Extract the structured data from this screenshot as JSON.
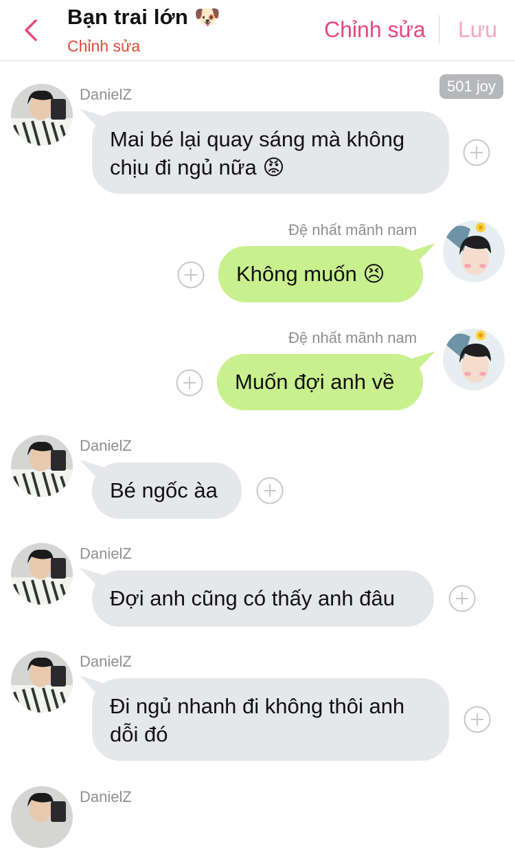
{
  "header": {
    "title": "Bạn trai lớn 🐶",
    "subtitle": "Chỉnh sửa",
    "edit_label": "Chỉnh sửa",
    "save_label": "Lưu"
  },
  "joy_badge": "501 joy",
  "messages": [
    {
      "sender": "DanielZ",
      "text": "Mai bé lại quay sáng mà không chịu đi ngủ nữa 😡",
      "side": "in"
    },
    {
      "sender": "Đệ nhất mãnh nam",
      "text": "Không muốn 😣",
      "side": "out"
    },
    {
      "sender": "Đệ nhất mãnh nam",
      "text": "Muốn đợi anh về",
      "side": "out"
    },
    {
      "sender": "DanielZ",
      "text": "Bé ngốc àa",
      "side": "in"
    },
    {
      "sender": "DanielZ",
      "text": "Đợi anh cũng có thấy anh đâu",
      "side": "in"
    },
    {
      "sender": "DanielZ",
      "text": "Đi ngủ nhanh đi không thôi anh dỗi đó",
      "side": "in"
    },
    {
      "sender": "DanielZ",
      "text": "",
      "side": "in"
    }
  ],
  "colors": {
    "accent": "#e8467f",
    "incoming_bubble": "#e5e7ea",
    "outgoing_bubble": "#c9f08e",
    "subtitle": "#e0493a"
  }
}
